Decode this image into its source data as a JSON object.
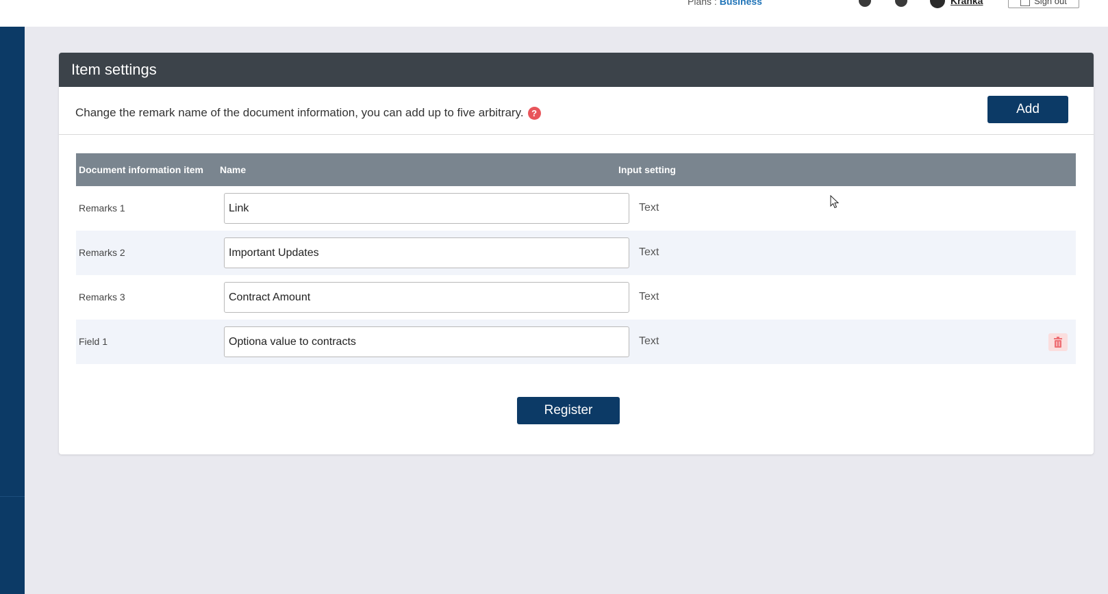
{
  "topbar": {
    "plan_label": "Plans :",
    "plan_value": "Business",
    "user_name": "Kranka",
    "sign_out_label": "Sign out"
  },
  "panel": {
    "title": "Item settings",
    "description": "Change the remark name of the document information, you can add up to five arbitrary.",
    "help_icon_text": "?",
    "add_label": "Add",
    "register_label": "Register"
  },
  "table": {
    "headers": {
      "item": "Document information item",
      "name": "Name",
      "setting": "Input setting"
    },
    "rows": [
      {
        "item": "Remarks 1",
        "name": "Link",
        "setting": "Text"
      },
      {
        "item": "Remarks 2",
        "name": "Important Updates",
        "setting": "Text"
      },
      {
        "item": "Remarks 3",
        "name": "Contract Amount",
        "setting": "Text"
      },
      {
        "item": "Field 1",
        "name": "Optiona value to contracts",
        "setting": "Text"
      }
    ]
  },
  "icons": {
    "help": "question-circle-icon",
    "delete": "trash-icon",
    "user": "user-avatar-icon"
  },
  "colors": {
    "primary": "#0c3a66",
    "header_dark": "#3c434a",
    "table_header": "#7a858f",
    "danger": "#e8555b"
  }
}
